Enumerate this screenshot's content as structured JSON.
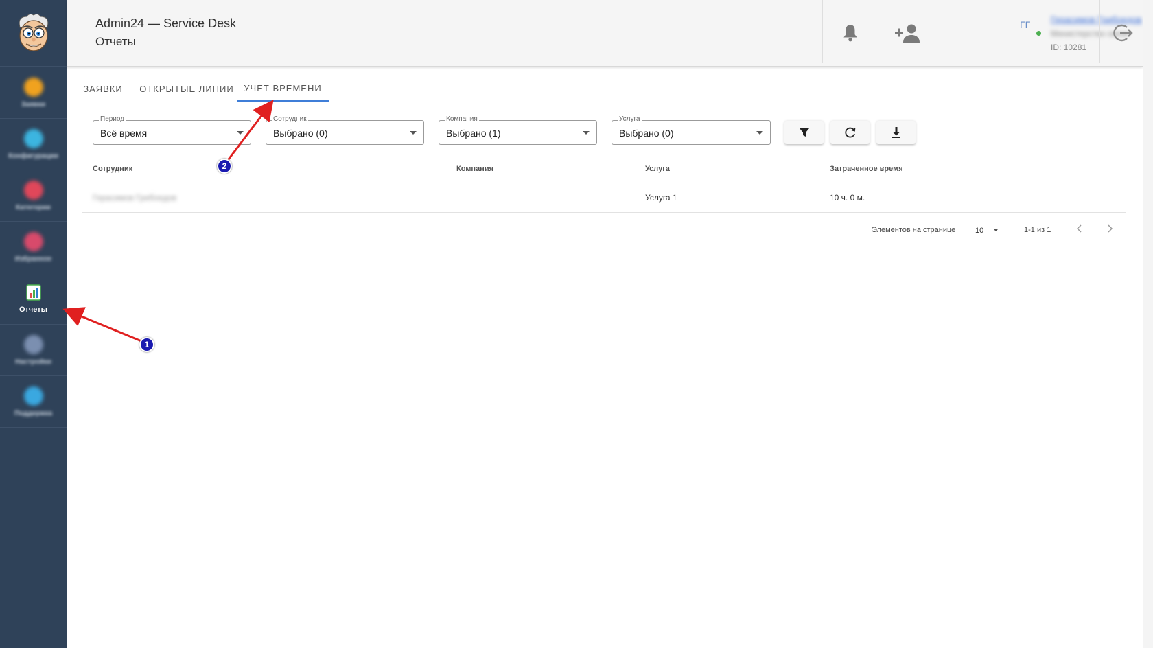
{
  "header": {
    "app_title": "Admin24 — Service Desk",
    "page_title": "Отчеты",
    "user_initials": "ГГ",
    "user_name": "Герасимов Грибоедов",
    "user_org": "Министерство связи",
    "user_id": "ID: 10281"
  },
  "sidebar": {
    "items": [
      {
        "label": "Заявки",
        "icon": "folder-icon",
        "color": "#f0a21f"
      },
      {
        "label": "Конфигурации",
        "icon": "globe-icon",
        "color": "#3cb5e0"
      },
      {
        "label": "Категории",
        "icon": "category-icon",
        "color": "#e0475a"
      },
      {
        "label": "Избранное",
        "icon": "heart-icon",
        "color": "#d84a6b"
      },
      {
        "label": "Отчеты",
        "icon": "report-icon",
        "color": "#4caf50"
      },
      {
        "label": "Настройки",
        "icon": "settings-icon",
        "color": "#7b8fb0"
      },
      {
        "label": "Поддержка",
        "icon": "support-icon",
        "color": "#3aa8e0"
      }
    ]
  },
  "tabs": [
    {
      "label": "Заявки"
    },
    {
      "label": "Открытые линии"
    },
    {
      "label": "Учет времени",
      "active": true
    }
  ],
  "filters": {
    "period": {
      "label": "Период",
      "value": "Всё время"
    },
    "employee": {
      "label": "Сотрудник",
      "value": "Выбрано (0)"
    },
    "company": {
      "label": "Компания",
      "value": "Выбрано (1)"
    },
    "service": {
      "label": "Услуга",
      "value": "Выбрано (0)"
    }
  },
  "toolbar": {
    "filter_icon": "filter-icon",
    "refresh_icon": "refresh-icon",
    "download_icon": "download-icon"
  },
  "table": {
    "columns": [
      "Сотрудник",
      "Компания",
      "Услуга",
      "Затраченное время"
    ],
    "rows": [
      {
        "employee": "Герасимов Грибоедов",
        "company": "",
        "service": "Услуга 1",
        "time": "10 ч. 0 м."
      }
    ]
  },
  "pagination": {
    "per_page_label": "Элементов на странице",
    "per_page_value": "10",
    "range": "1-1 из 1"
  },
  "annotations": {
    "marker1": "1",
    "marker2": "2",
    "arrow_color": "#e02020",
    "marker_color": "#1a1ab0"
  }
}
